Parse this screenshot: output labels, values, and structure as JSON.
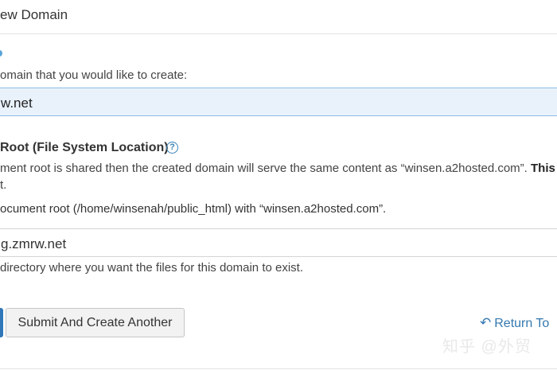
{
  "form": {
    "title": "ew Domain",
    "domain_help": "omain that you would like to create:",
    "domain_value": "w.net",
    "docroot_label": "Root (File System Location)",
    "help_icon_glyph": "?",
    "shared_note_start": "ment root is shared then the created domain will serve the same content as “winsen.a2hosted.com”.",
    "shared_note_bold": "This s",
    "shared_note_line2": "t.",
    "replace_note": "ocument root (/home/winsenah/public_html) with “winsen.a2hosted.com”.",
    "docroot_value": "g.zmrw.net",
    "docroot_help": "directory where you want the files for this domain to exist."
  },
  "actions": {
    "submit_another_label": "Submit And Create Another",
    "return_label": "Return To",
    "return_icon": "return-arrow-icon"
  },
  "watermark": "知乎 @外贸",
  "colors": {
    "accent": "#3478b0",
    "input_focus_bg": "#e9f2fb",
    "primary_button": "#2f77b8"
  }
}
